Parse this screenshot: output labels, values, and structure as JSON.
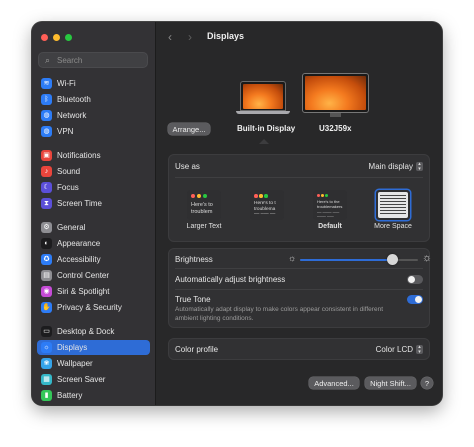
{
  "window": {
    "traffic_lights": [
      "#ff5f57",
      "#febc2e",
      "#28c840"
    ]
  },
  "search": {
    "placeholder": "Search"
  },
  "sidebar": {
    "items": [
      {
        "label": "Wi-Fi",
        "icon": "wifi-icon",
        "color": "#2d7cf6",
        "glyph": "≋"
      },
      {
        "label": "Bluetooth",
        "icon": "bluetooth-icon",
        "color": "#2d7cf6",
        "glyph": "ᛒ"
      },
      {
        "label": "Network",
        "icon": "globe-icon",
        "color": "#2d7cf6",
        "glyph": "◍"
      },
      {
        "label": "VPN",
        "icon": "vpn-globe-icon",
        "color": "#2d7cf6",
        "glyph": "◍"
      },
      {
        "label": "Notifications",
        "icon": "bell-icon",
        "color": "#e9453c",
        "glyph": "▣"
      },
      {
        "label": "Sound",
        "icon": "speaker-icon",
        "color": "#e9453c",
        "glyph": "♪"
      },
      {
        "label": "Focus",
        "icon": "moon-icon",
        "color": "#5b4fd8",
        "glyph": "☾"
      },
      {
        "label": "Screen Time",
        "icon": "hourglass-icon",
        "color": "#5b4fd8",
        "glyph": "⧗"
      },
      {
        "label": "General",
        "icon": "gear-icon",
        "color": "#8e8e93",
        "glyph": "⚙"
      },
      {
        "label": "Appearance",
        "icon": "appearance-icon",
        "color": "#1c1c1e",
        "glyph": "◐"
      },
      {
        "label": "Accessibility",
        "icon": "accessibility-icon",
        "color": "#2d7cf6",
        "glyph": "✪"
      },
      {
        "label": "Control Center",
        "icon": "control-center-icon",
        "color": "#8e8e93",
        "glyph": "▤"
      },
      {
        "label": "Siri & Spotlight",
        "icon": "siri-icon",
        "color": "#c54bd6",
        "glyph": "◉"
      },
      {
        "label": "Privacy & Security",
        "icon": "hand-icon",
        "color": "#2d7cf6",
        "glyph": "✋"
      },
      {
        "label": "Desktop & Dock",
        "icon": "dock-icon",
        "color": "#1c1c1e",
        "glyph": "▭"
      },
      {
        "label": "Displays",
        "icon": "sun-icon",
        "color": "#2d7cf6",
        "glyph": "☼"
      },
      {
        "label": "Wallpaper",
        "icon": "wallpaper-icon",
        "color": "#35a3e8",
        "glyph": "❀"
      },
      {
        "label": "Screen Saver",
        "icon": "screen-saver-icon",
        "color": "#35b8c8",
        "glyph": "▦"
      },
      {
        "label": "Battery",
        "icon": "battery-icon",
        "color": "#34c759",
        "glyph": "▮"
      }
    ],
    "selected": "Displays"
  },
  "header": {
    "title": "Displays",
    "back": "‹",
    "forward": "›"
  },
  "displays": {
    "arrange_label": "Arrange...",
    "builtin_label": "Built-in Display",
    "external_label": "U32J59x"
  },
  "use_as": {
    "label": "Use as",
    "value": "Main display",
    "options": [
      {
        "label": "Larger Text",
        "preview": "Here's to\ntroublem",
        "selected": false
      },
      {
        "label": "",
        "preview": "Here's to t\ntroublema",
        "selected": false
      },
      {
        "label": "Default",
        "preview": "Here's to the\ntroublemakers",
        "selected": false
      },
      {
        "label": "More Space",
        "preview": "",
        "selected": true
      }
    ]
  },
  "brightness": {
    "label": "Brightness",
    "level": 0.78
  },
  "auto_brightness": {
    "label": "Automatically adjust brightness",
    "on": false
  },
  "true_tone": {
    "label": "True Tone",
    "on": true,
    "description": "Automatically adapt display to make colors appear consistent in different ambient lighting conditions."
  },
  "color_profile": {
    "label": "Color profile",
    "value": "Color LCD"
  },
  "footer": {
    "advanced_label": "Advanced...",
    "night_shift_label": "Night Shift...",
    "help_label": "?"
  },
  "accent_color": "#2e6cd6"
}
